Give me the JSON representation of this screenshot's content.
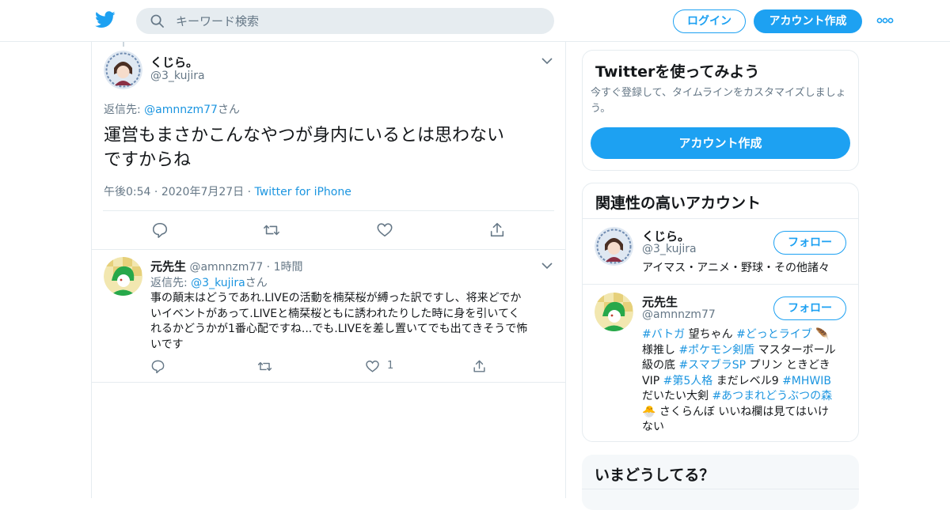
{
  "header": {
    "search_placeholder": "キーワード検索",
    "login_label": "ログイン",
    "signup_label": "アカウント作成"
  },
  "tweet": {
    "author_name": "くじら。",
    "author_handle": "@3_kujira",
    "reply_prefix": "返信先: ",
    "reply_to": "@amnnzm77",
    "reply_suffix": "さん",
    "text_line1": "運営もまさかこんなやつが身内にいるとは思わない",
    "text_line2": "ですからね",
    "time": "午後0:54",
    "date": "2020年7月27日",
    "source": "Twitter for iPhone"
  },
  "reply": {
    "author_name": "元先生",
    "author_handle": "@amnnzm77",
    "age": "1時間",
    "reply_prefix": "返信先: ",
    "reply_to": "@3_kujira",
    "reply_suffix": "さん",
    "text_lines": [
      "事の顛末はどうであれ.LIVEの活動を楠栞桜が縛った訳ですし、将来どでか",
      "いイベントがあって.LIVEと楠栞桜ともに誘われたりした時に身を引いてく",
      "れるかどうかが1番心配ですね...でも.LIVEを差し置いてでも出てきそうで怖",
      "いです"
    ],
    "like_count": "1"
  },
  "sidebar": {
    "signup_card": {
      "title": "Twitterを使ってみよう",
      "subtitle_line1": "今すぐ登録して、タイムラインをカスタマイズしましょ",
      "subtitle_line2": "う。",
      "button": "アカウント作成"
    },
    "related": {
      "title": "関連性の高いアカウント",
      "follow_label": "フォロー",
      "accounts": [
        {
          "name": "くじら。",
          "handle": "@3_kujira",
          "bio": "アイマス・アニメ・野球・その他諸々"
        },
        {
          "name": "元先生",
          "handle": "@amnnzm77",
          "bio_parts": [
            "#バトガ",
            " 望ちゃん ",
            "#どっとライブ",
            " 🪶",
            "様推し ",
            "#ポケモン剣盾",
            " マスターボール",
            "級の底 ",
            "#スマブラSP",
            " プリン ときどき",
            "VIP ",
            "#第5人格",
            " まだレベル9 ",
            "#MHWIB",
            "だいたい大剣 ",
            "#あつまれどうぶつの森",
            "🐣 さくらんぼ いいね欄は見てはいけ",
            "ない"
          ]
        }
      ]
    },
    "trends": {
      "title": "いまどうしてる？"
    }
  },
  "colors": {
    "accent": "#1da1f2",
    "link": "#1b95e0",
    "muted": "#657786",
    "border": "#e6ecf0"
  }
}
